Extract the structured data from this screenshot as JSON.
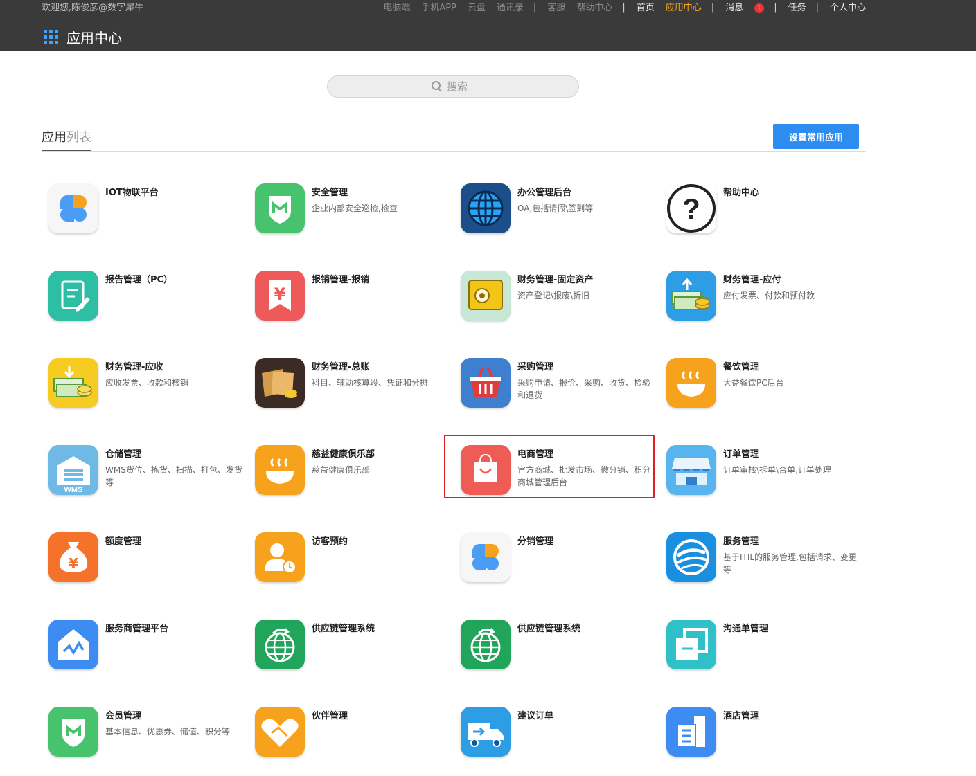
{
  "header": {
    "welcome": "欢迎您,陈俊彦@数字犀牛",
    "nav": [
      {
        "label": "电脑端",
        "style": "dim"
      },
      {
        "label": "手机APP",
        "style": "dim"
      },
      {
        "label": "云盘",
        "style": "dim"
      },
      {
        "label": "通讯录",
        "style": "dim"
      },
      {
        "label": "|",
        "style": "sep"
      },
      {
        "label": "客服",
        "style": "dim"
      },
      {
        "label": "帮助中心",
        "style": "dim"
      },
      {
        "label": "|",
        "style": "sep"
      },
      {
        "label": "首页",
        "style": "main"
      },
      {
        "label": "应用中心",
        "style": "active"
      },
      {
        "label": "|",
        "style": "sep"
      },
      {
        "label": "消息",
        "style": "main",
        "badge": "1"
      },
      {
        "label": "|",
        "style": "sep"
      },
      {
        "label": "任务",
        "style": "main"
      },
      {
        "label": "|",
        "style": "sep"
      },
      {
        "label": "个人中心",
        "style": "main"
      }
    ],
    "brand_title": "应用中心"
  },
  "search": {
    "placeholder": "搜索"
  },
  "list": {
    "title_a": "应用",
    "title_b": "列表",
    "set_button": "设置常用应用"
  },
  "apps": [
    {
      "name": "IOT物联平台",
      "desc": "",
      "icon": "clover-icon",
      "color": "#f6f6f6"
    },
    {
      "name": "安全管理",
      "desc": "企业内部安全巡检,检查",
      "icon": "shield-icon",
      "color": "#47c26d"
    },
    {
      "name": "办公管理后台",
      "desc": "OA,包括请假\\签到等",
      "icon": "globe-icon",
      "color": "#1c4f8a"
    },
    {
      "name": "帮助中心",
      "desc": "",
      "icon": "question-icon",
      "color": "#ffffff"
    },
    {
      "name": "报告管理（PC）",
      "desc": "",
      "icon": "report-icon",
      "color": "#2cbfa3"
    },
    {
      "name": "报销管理-报销",
      "desc": "",
      "icon": "yen-bookmark-icon",
      "color": "#ee5a5a"
    },
    {
      "name": "财务管理-固定资产",
      "desc": "资产登记\\报废\\折旧",
      "icon": "safe-icon",
      "color": "#3bbf73"
    },
    {
      "name": "财务管理-应付",
      "desc": "应付发票、付款和预付款",
      "icon": "cash-out-icon",
      "color": "#2d9ee6"
    },
    {
      "name": "财务管理-应收",
      "desc": "应收发票、收款和核销",
      "icon": "cash-in-icon",
      "color": "#f7cc22"
    },
    {
      "name": "财务管理-总账",
      "desc": "科目、辅助核算段、凭证和分摊",
      "icon": "wallet-icon",
      "color": "#3b2b24"
    },
    {
      "name": "采购管理",
      "desc": "采购申请、报价、采购、收货、检验和退货",
      "icon": "basket-icon",
      "color": "#3f7fd0"
    },
    {
      "name": "餐饮管理",
      "desc": "大益餐饮PC后台",
      "icon": "bowl-icon",
      "color": "#f7a21c"
    },
    {
      "name": "仓储管理",
      "desc": "WMS货位、拣货、扫描、打包、发货等",
      "icon": "warehouse-icon",
      "color": "#6fb9e6"
    },
    {
      "name": "慈益健康俱乐部",
      "desc": "慈益健康俱乐部",
      "icon": "bowl-icon",
      "color": "#f7a21c"
    },
    {
      "name": "电商管理",
      "desc": "官方商城、批发市场、微分销、积分商城管理后台",
      "icon": "shopping-bag-icon",
      "color": "#ef5b55"
    },
    {
      "name": "订单管理",
      "desc": "订单审核\\拆单\\合单,订单处理",
      "icon": "storefront-icon",
      "color": "#58b4ee"
    },
    {
      "name": "额度管理",
      "desc": "",
      "icon": "money-bag-icon",
      "color": "#f5722a"
    },
    {
      "name": "访客预约",
      "desc": "",
      "icon": "visitor-icon",
      "color": "#f7a21c"
    },
    {
      "name": "分销管理",
      "desc": "",
      "icon": "clover-icon",
      "color": "#f6f6f6"
    },
    {
      "name": "服务管理",
      "desc": "基于ITIL的服务管理,包括请求、变更等",
      "icon": "swirl-icon",
      "color": "#1a8fe0"
    },
    {
      "name": "服务商管理平台",
      "desc": "",
      "icon": "house-chart-icon",
      "color": "#3d8cf2"
    },
    {
      "name": "供应链管理系统",
      "desc": "",
      "icon": "globe-arrow-icon",
      "color": "#21a55b"
    },
    {
      "name": "供应链管理系统",
      "desc": "",
      "icon": "globe-arrow-icon",
      "color": "#21a55b"
    },
    {
      "name": "沟通单管理",
      "desc": "",
      "icon": "layers-icon",
      "color": "#2fc0c8"
    },
    {
      "name": "会员管理",
      "desc": "基本信息、优惠券、储值、积分等",
      "icon": "shield-icon",
      "color": "#47c26d"
    },
    {
      "name": "伙伴管理",
      "desc": "",
      "icon": "handshake-icon",
      "color": "#f7a21c"
    },
    {
      "name": "建议订单",
      "desc": "",
      "icon": "truck-icon",
      "color": "#2d9ee6"
    },
    {
      "name": "酒店管理",
      "desc": "",
      "icon": "building-icon",
      "color": "#3d8cf2"
    }
  ]
}
